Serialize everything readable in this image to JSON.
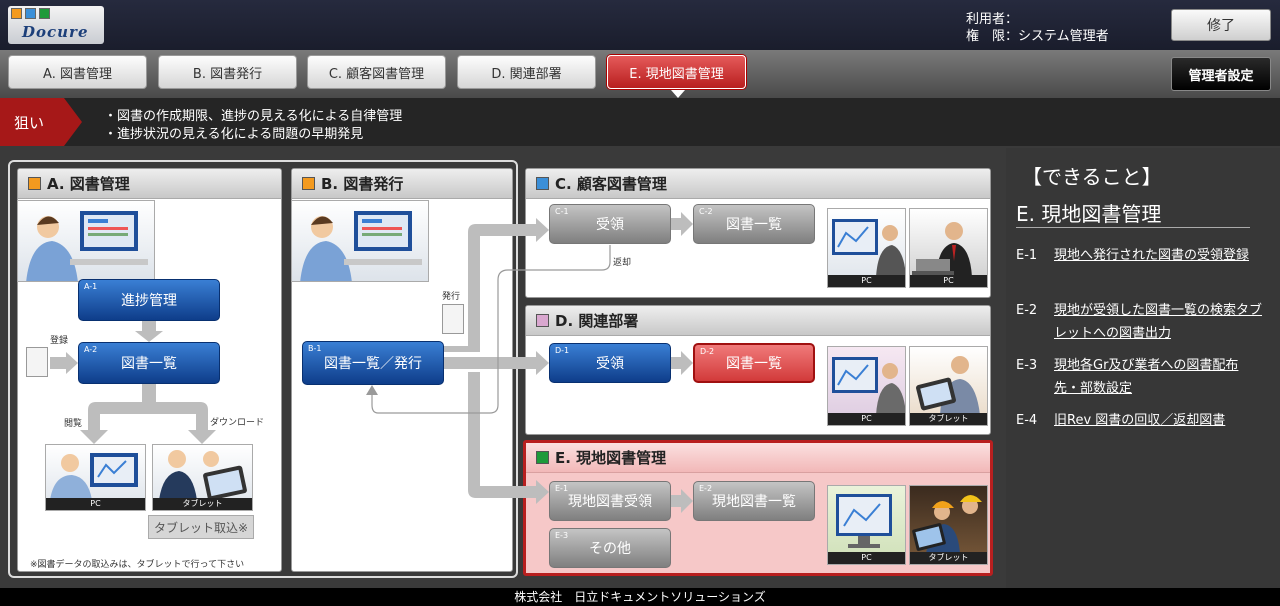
{
  "app": {
    "logo_text": "Docure"
  },
  "header": {
    "user_label": "利用者：",
    "role_label": "権　限：システム管理者",
    "quit_label": "修了"
  },
  "tabs": [
    {
      "label": "A. 図書管理"
    },
    {
      "label": "B. 図書発行"
    },
    {
      "label": "C. 顧客図書管理"
    },
    {
      "label": "D. 関連部署"
    },
    {
      "label": "E. 現地図書管理",
      "active": true
    }
  ],
  "admin_label": "管理者設定",
  "goal": {
    "label": "狙い",
    "lines": [
      "・図書の作成期限、進捗の見える化による自律管理",
      "・進捗状況の見える化による問題の早期発見"
    ]
  },
  "panelA": {
    "title": "A. 図書管理",
    "node1": {
      "code": "A-1",
      "label": "進捗管理"
    },
    "node2": {
      "code": "A-2",
      "label": "図書一覧"
    },
    "register_label": "登録",
    "view_label": "閲覧",
    "download_label": "ダウンロード",
    "pc_label": "PC",
    "tablet_label": "タブレット",
    "tablet_import_label": "タブレット取込※",
    "note": "※図書データの取込みは、タブレットで行って下さい"
  },
  "panelB": {
    "title": "B. 図書発行",
    "issue_label": "発行",
    "node": {
      "code": "B-1",
      "label": "図書一覧／発行"
    }
  },
  "panelC": {
    "title": "C. 顧客図書管理",
    "node1": {
      "code": "C-1",
      "label": "受領"
    },
    "node2": {
      "code": "C-2",
      "label": "図書一覧"
    },
    "return_label": "返却",
    "pc_label1": "PC",
    "pc_label2": "PC"
  },
  "panelD": {
    "title": "D. 関連部署",
    "node1": {
      "code": "D-1",
      "label": "受領"
    },
    "node2": {
      "code": "D-2",
      "label": "図書一覧"
    },
    "pc_label": "PC",
    "tablet_label": "タブレット"
  },
  "panelE": {
    "title": "E. 現地図書管理",
    "node1": {
      "code": "E-1",
      "label": "現地図書受領"
    },
    "node2": {
      "code": "E-2",
      "label": "現地図書一覧"
    },
    "node3": {
      "code": "E-3",
      "label": "その他"
    },
    "pc_label": "PC",
    "tablet_label": "タブレット"
  },
  "right_panel": {
    "heading": "【できること】",
    "subheading": "E. 現地図書管理",
    "items": [
      {
        "code": "E-1",
        "text": "現地へ発行された図書の受領登録"
      },
      {
        "code": "E-2",
        "text": "現地が受領した図書一覧の検索タブレットへの図書出力"
      },
      {
        "code": "E-3",
        "text": "現地各Gr及び業者への図書配布先・部数設定"
      },
      {
        "code": "E-4",
        "text": "旧Rev 図書の回収／返却図書"
      }
    ]
  },
  "footer": "株式会社　日立ドキュメントソリューションズ",
  "colors": {
    "accent_red": "#b81f1f",
    "node_blue": "#0e3d8a",
    "panel_a_icon": "#f39a1f",
    "panel_c_icon": "#3b8fd8",
    "panel_d_icon": "#d9a7cf",
    "panel_e_icon": "#1e9a3a"
  }
}
